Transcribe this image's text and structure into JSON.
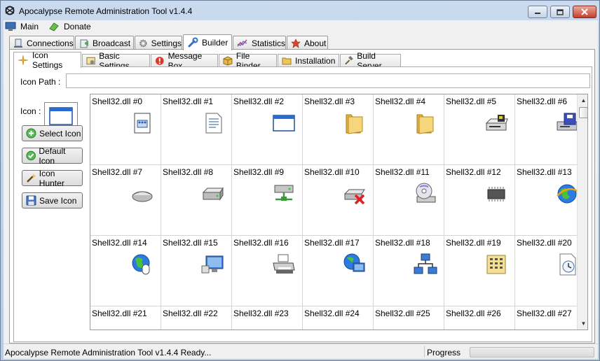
{
  "window": {
    "title": "Apocalypse Remote Administration Tool v1.4.4"
  },
  "menu": [
    {
      "label": "Main",
      "icon": "computer-icon"
    },
    {
      "label": "Donate",
      "icon": "money-icon"
    }
  ],
  "main_tabs": [
    {
      "label": "Connections",
      "icon": "connections-icon",
      "active": false
    },
    {
      "label": "Broadcast",
      "icon": "broadcast-icon",
      "active": false
    },
    {
      "label": "Settings",
      "icon": "gear-icon",
      "active": false
    },
    {
      "label": "Builder",
      "icon": "wrench-icon",
      "active": true
    },
    {
      "label": "Statistics",
      "icon": "chart-icon",
      "active": false
    },
    {
      "label": "About",
      "icon": "about-icon",
      "active": false
    }
  ],
  "builder_tabs": [
    {
      "label": "Icon Settings",
      "icon": "sparkle-icon",
      "active": true
    },
    {
      "label": "Basic Settings",
      "icon": "settings-icon",
      "active": false
    },
    {
      "label": "Message Box",
      "icon": "error-icon",
      "active": false
    },
    {
      "label": "File Binder",
      "icon": "box-icon",
      "active": false
    },
    {
      "label": "Installation",
      "icon": "folder-icon",
      "active": false
    },
    {
      "label": "Build Server",
      "icon": "hammer-icon",
      "active": false
    }
  ],
  "icon_settings": {
    "icon_path_label": "Icon Path :",
    "icon_path_value": "",
    "icon_label": "Icon :",
    "buttons": [
      {
        "label": "Select Icon",
        "icon": "plus-icon"
      },
      {
        "label": "Default Icon",
        "icon": "check-icon"
      },
      {
        "label": "Icon Hunter",
        "icon": "wand-icon"
      },
      {
        "label": "Save Icon",
        "icon": "floppy-icon"
      }
    ]
  },
  "icons": [
    {
      "label": "Shell32.dll #0",
      "icon": "document-icon"
    },
    {
      "label": "Shell32.dll #1",
      "icon": "text-document-icon"
    },
    {
      "label": "Shell32.dll #2",
      "icon": "application-window-icon"
    },
    {
      "label": "Shell32.dll #3",
      "icon": "folder-icon"
    },
    {
      "label": "Shell32.dll #4",
      "icon": "folder-icon"
    },
    {
      "label": "Shell32.dll #5",
      "icon": "floppy-drive-icon"
    },
    {
      "label": "Shell32.dll #6",
      "icon": "drive-icon"
    },
    {
      "label": "Shell32.dll #7",
      "icon": "removable-drive-icon"
    },
    {
      "label": "Shell32.dll #8",
      "icon": "hard-drive-icon"
    },
    {
      "label": "Shell32.dll #9",
      "icon": "network-drive-icon"
    },
    {
      "label": "Shell32.dll #10",
      "icon": "disconnected-drive-icon"
    },
    {
      "label": "Shell32.dll #11",
      "icon": "cd-drive-icon"
    },
    {
      "label": "Shell32.dll #12",
      "icon": "chip-icon"
    },
    {
      "label": "Shell32.dll #13",
      "icon": "globe-icon"
    },
    {
      "label": "Shell32.dll #14",
      "icon": "globe-mouse-icon"
    },
    {
      "label": "Shell32.dll #15",
      "icon": "monitor-icon"
    },
    {
      "label": "Shell32.dll #16",
      "icon": "printer-icon"
    },
    {
      "label": "Shell32.dll #17",
      "icon": "globe-monitor-icon"
    },
    {
      "label": "Shell32.dll #18",
      "icon": "network-icon"
    },
    {
      "label": "Shell32.dll #19",
      "icon": "keypad-icon"
    },
    {
      "label": "Shell32.dll #20",
      "icon": "clock-document-icon"
    },
    {
      "label": "Shell32.dll #21",
      "icon": "window-icon"
    },
    {
      "label": "Shell32.dll #22",
      "icon": "search-icon"
    },
    {
      "label": "Shell32.dll #23",
      "icon": "help-icon"
    },
    {
      "label": "Shell32.dll #24",
      "icon": "window-icon"
    },
    {
      "label": "Shell32.dll #25",
      "icon": "shutdown-icon"
    },
    {
      "label": "Shell32.dll #26",
      "icon": "check-icon"
    },
    {
      "label": "Shell32.dll #27",
      "icon": "power-icon"
    }
  ],
  "statusbar": {
    "text": "Apocalypse Remote Administration Tool v1.4.4 Ready...",
    "progress_label": "Progress",
    "progress_value": 0
  }
}
